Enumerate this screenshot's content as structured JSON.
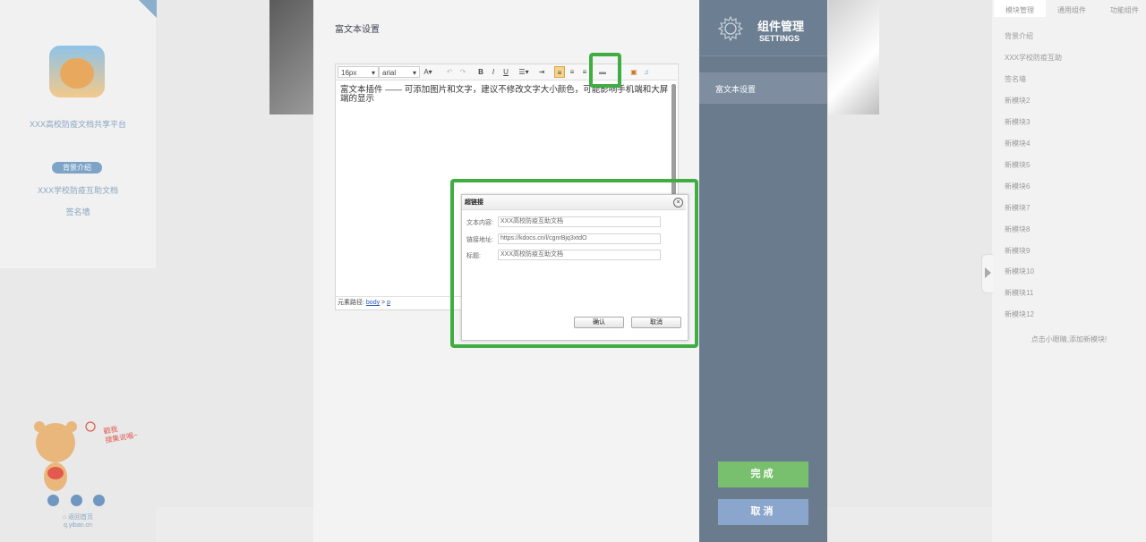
{
  "left_sidebar": {
    "platform_title": "XXX高校防疫文档共享平台",
    "nav_items": [
      "背景介绍",
      "XXX学校防疫互助文档",
      "签名墙"
    ],
    "bear_caption": "戳我\n搜集说唱~",
    "back_home": "返回首页",
    "site_url": "q.yiban.cn"
  },
  "right_sidebar": {
    "tabs": [
      "模块管理",
      "通用组件",
      "功能组件"
    ],
    "modules": [
      "背景介绍",
      "XXX学校防疫互助",
      "签名墙",
      "新模块2",
      "新模块3",
      "新模块4",
      "新模块5",
      "新模块6",
      "新模块7",
      "新模块8",
      "新模块9",
      "新模块10",
      "新模块11",
      "新模块12"
    ],
    "add_hint": "点击小眼睛,添加新模块!"
  },
  "editor": {
    "section_title": "富文本设置",
    "font_size": "16px",
    "font_family": "arial",
    "content": "富文本插件 —— 可添加图片和文字，建议不修改文字大小颜色，可能影响手机端和大屏端的显示",
    "path_label": "元素路径:",
    "path_body": "body",
    "path_sep": " > ",
    "path_p": "p"
  },
  "link_dialog": {
    "title": "超链接",
    "text_label": "文本内容:",
    "text_value": "XXX高校防疫互助文档",
    "url_label": "链接地址:",
    "url_value": "https://kdocs.cn/l/cgnrBjq3xtdO",
    "title_label": "标题:",
    "title_value": "XXX高校防疫互助文档",
    "confirm": "确认",
    "cancel": "取消",
    "close_glyph": "×"
  },
  "settings": {
    "title_cn": "组件管理",
    "title_en": "SETTINGS",
    "item": "富文本设置",
    "done": "完成",
    "cancel": "取消"
  },
  "colors": {
    "highlight": "#3fad42",
    "settings_panel": "#6a7b8e",
    "done_button": "#78c06e",
    "cancel_button": "#8aa6cc"
  }
}
